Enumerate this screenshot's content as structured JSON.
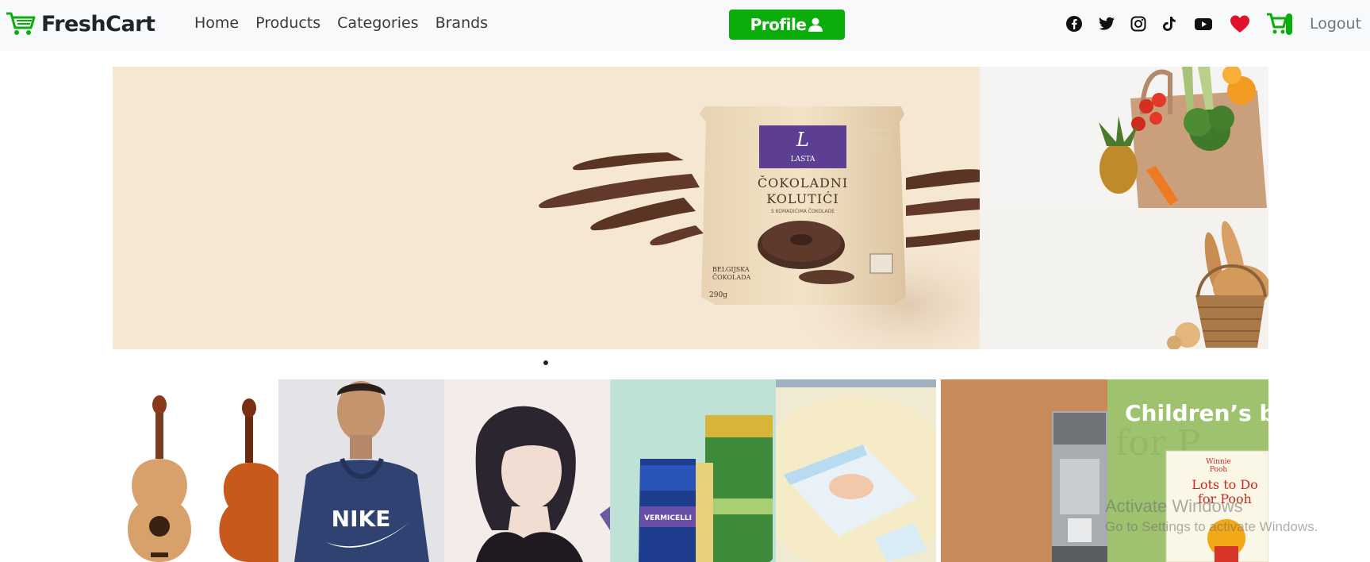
{
  "brand": {
    "name": "FreshCart",
    "icon": "cart-icon",
    "color": "#0aad0a"
  },
  "nav": {
    "links": [
      "Home",
      "Products",
      "Categories",
      "Brands"
    ],
    "profile_label": "Profile",
    "logout_label": "Logout",
    "social_icons": [
      "facebook-icon",
      "twitter-icon",
      "instagram-icon",
      "tiktok-icon",
      "youtube-icon"
    ]
  },
  "hero": {
    "main_slide": {
      "product_brand": "LASTA",
      "product_name_line1": "ČOKOLADNI",
      "product_name_line2": "KOLUTIĆI",
      "product_sub": "S KOMADIĆIMA ČOKOLADE",
      "origin_line1": "BELGIJSKA",
      "origin_line2": "ČOKOLADA",
      "weight": "290g"
    },
    "side_top": "grocery-bag-image",
    "side_bottom": "bread-basket-image",
    "carousel_active_index": 0
  },
  "categories": [
    {
      "name": "music-category",
      "image": "guitars-image"
    },
    {
      "name": "mens-fashion-category",
      "image": "nike-hoodie-image",
      "logo_text": "NIKE"
    },
    {
      "name": "womens-fashion-category",
      "image": "woman-portrait-image"
    },
    {
      "name": "supermarket-category",
      "image": "groceries-image",
      "label": "VERMICELLI"
    },
    {
      "name": "baby-toys-category",
      "image": "diapers-image"
    },
    {
      "name": "home-category",
      "image": "coffee-machine-image"
    },
    {
      "name": "books-category",
      "image": "childrens-books-image",
      "headline": "Children’s b",
      "book_title_line1": "Lots to Do",
      "book_title_line2": "for Pooh",
      "book_series_line1": "Winnie",
      "book_series_line2": "Pooh"
    }
  ],
  "watermark": {
    "line1": "Activate Windows",
    "line2": "Go to Settings to activate Windows."
  },
  "colors": {
    "accent": "#0aad0a",
    "heart": "#e0112b",
    "navbar_bg": "#f8f9fa"
  }
}
